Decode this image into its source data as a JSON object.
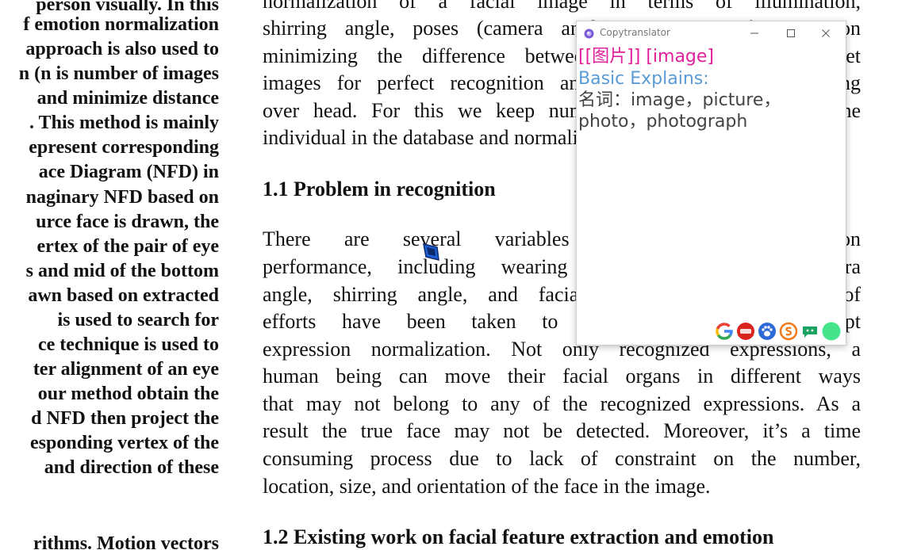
{
  "left_column": {
    "lines": [
      "person visually.  In this",
      "f emotion normalization",
      "approach is also used to",
      "n (n is number of images",
      "and  minimize  distance",
      ". This method is mainly",
      "epresent  corresponding",
      "ace  Diagram  (NFD)  in",
      "naginary NFD based on",
      "urce  face  is  drawn,  the",
      "ertex  of  the  pair  of  eye",
      "s and mid of the bottom",
      "awn based on extracted",
      "is  used  to  search  for",
      "ce  technique  is  used  to",
      "ter  alignment  of  an  eye",
      "our  method  obtain  the",
      "d  NFD  then  project  the",
      "esponding  vertex  of  the",
      "and  direction  of  these",
      "rithms.  Motion vectors"
    ]
  },
  "right_column": {
    "para1": [
      "normalization of a facial image in terms of illumination,",
      "shirring angle, poses (camera angle). Our main focus is on",
      "minimizing the difference between the input and the target",
      "images for perfect recognition and at the same time reducing",
      "over head. For this we keep number of image of each of the",
      "individual in the database and normalize them."
    ],
    "heading1": "1.1 Problem in recognition",
    "para2": [
      "There  are  several  variables  which  affect  recognition",
      "performance, including wearing glasses, pose and camera",
      "angle, shirring angle, and facial expressions. A number of",
      "efforts have been taken to overcome these and adopt",
      "expression normalization. Not only recognized expressions, a",
      "human being can move their facial organs in different ways",
      "that may not belong to any of the recognized expressions. As a",
      "result the true face may not be detected. Moreover, it’s a time",
      "consuming process due to lack of constraint on the number,",
      "location, size, and orientation of the face in the image."
    ],
    "heading2": "1.2 Existing work on facial feature extraction and emotion"
  },
  "popup": {
    "title": "Copytranslator",
    "translation": "[[图片]] [image]",
    "basic_label": "Basic Explains:",
    "definition_line1": "名词：image，picture，",
    "definition_line2": "photo，photograph",
    "engines": [
      "google-icon",
      "youdao-icon",
      "baidu-icon",
      "sogou-icon",
      "caiyun-icon",
      "green-circle-icon"
    ],
    "colors": {
      "translation": "#e0209c",
      "label": "#5b9bd5",
      "definition": "#444444"
    }
  }
}
